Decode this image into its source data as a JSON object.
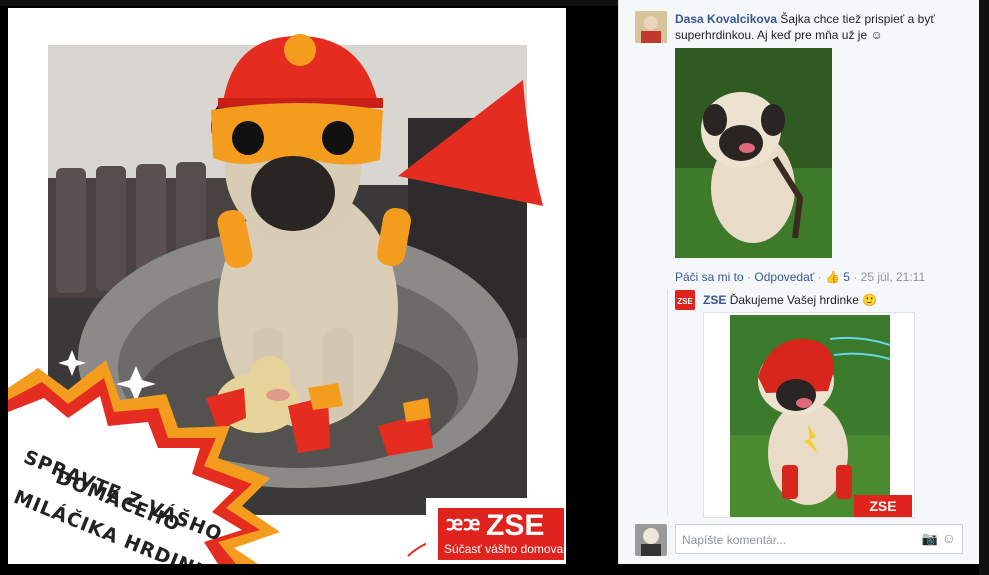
{
  "photo": {
    "burst_lines": [
      "SPRAVTE Z VÁŠHO",
      "DOMÁCEHO",
      "MILÁČIKA HRDINU!"
    ],
    "brand": "ZSE",
    "brand_mark": "ꭢꭢ",
    "tagline": "Súčasť vášho domova"
  },
  "comments": [
    {
      "author": "Dasa Kovalcikova",
      "text": "Šajka chce tiež prispieť a byť superhrdinkou. Aj keď pre mňa už je ☺",
      "like_label": "Páči sa mi to",
      "reply_label": "Odpovedať",
      "like_count": "5",
      "timestamp": "25 júl, 21:11"
    }
  ],
  "reply": {
    "author": "ZSE",
    "text": "Ďakujeme Vašej hrdinke 🙂",
    "logo_text": "ZSE"
  },
  "composer": {
    "placeholder": "Napíšte komentár..."
  },
  "colors": {
    "brand_red": "#e0231c",
    "fb_link": "#365899",
    "panel_bg": "#f6f7f9"
  },
  "icons": [
    "thumbs-up-icon",
    "camera-icon",
    "emoji-icon"
  ]
}
